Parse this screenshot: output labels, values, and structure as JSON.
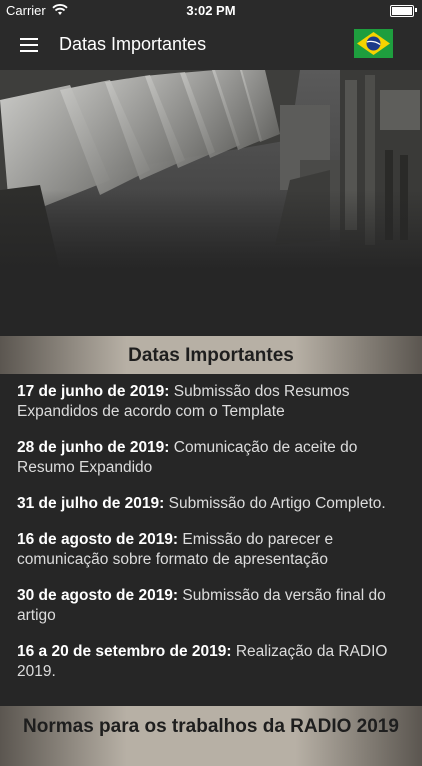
{
  "status_bar": {
    "carrier": "Carrier",
    "time": "3:02 PM"
  },
  "app_bar": {
    "title": "Datas Importantes",
    "menu_icon": "hamburger-menu-icon",
    "flag_icon": "brazil-flag-icon"
  },
  "hero": {
    "image": "dam-spillway-photo"
  },
  "section1": {
    "title": "Datas Importantes",
    "items": [
      {
        "date": "17 de junho de 2019:",
        "text": " Submissão dos Resumos Expandidos de acordo com o Template"
      },
      {
        "date": "28 de junho de 2019:",
        "text": " Comunicação de aceite do Resumo Expandido"
      },
      {
        "date": "31 de julho de 2019:",
        "text": " Submissão do Artigo Completo."
      },
      {
        "date": "16 de agosto de 2019:",
        "text": " Emissão do parecer e comunicação sobre formato de apresentação"
      },
      {
        "date": "30 de agosto de 2019:",
        "text": " Submissão da versão final do artigo"
      },
      {
        "date": "16 a 20 de setembro de 2019:",
        "text": " Realização da RADIO 2019."
      }
    ]
  },
  "section2": {
    "title": "Normas para os trabalhos da RADIO 2019"
  },
  "colors": {
    "background": "#262626",
    "header_gradient_center": "#b7b0a5",
    "flag_green": "#1e9e3e",
    "flag_yellow": "#f5d300",
    "flag_blue": "#1c3b8a"
  }
}
